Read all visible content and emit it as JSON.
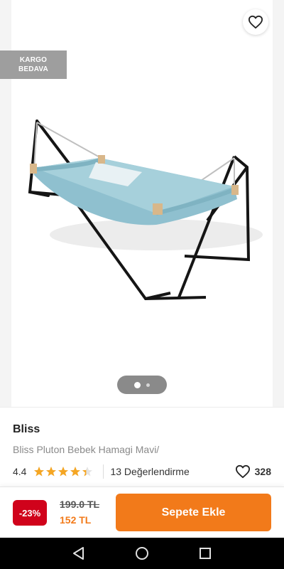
{
  "header": {
    "back_icon": "arrow-left-icon",
    "share_icon": "share-icon",
    "favorite_icon": "heart-outline-icon"
  },
  "badge": {
    "cargo_line1": "KARGO",
    "cargo_line2": "BEDAVA"
  },
  "gallery": {
    "pages": 2,
    "active_page": 1
  },
  "product": {
    "brand": "Bliss",
    "name": "Bliss Pluton Bebek Hamagi Mavi/",
    "rating": "4.4",
    "rating_value": 4.4,
    "reviews": "13 Değerlendirme",
    "likes": "328"
  },
  "buy": {
    "discount": "-23%",
    "old_price": "199.0 TL",
    "new_price": "152 TL",
    "cart_label": "Sepete Ekle"
  },
  "colors": {
    "accent": "#f27a1a",
    "discount": "#d0021b",
    "star": "#f5a623",
    "badge": "#9e9e9e"
  }
}
